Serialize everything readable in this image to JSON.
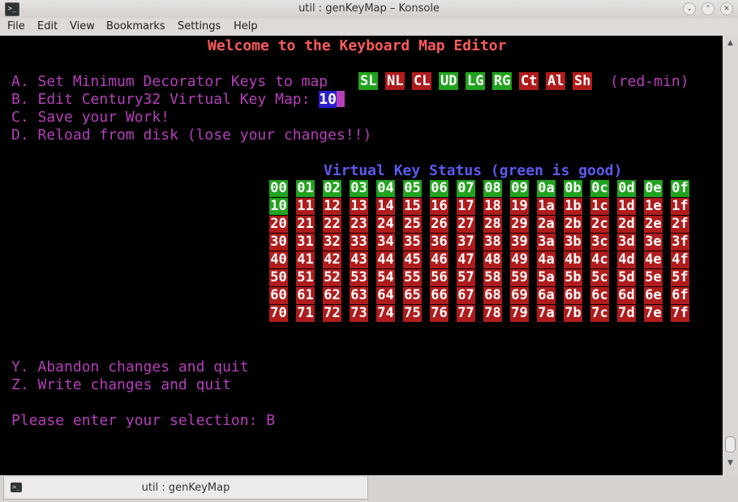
{
  "window": {
    "title": "util : genKeyMap – Konsole"
  },
  "menu": [
    "File",
    "Edit",
    "View",
    "Bookmarks",
    "Settings",
    "Help"
  ],
  "screen": {
    "header": "Welcome to the Keyboard Map Editor",
    "option_a": "A. Set Minimum Decorator Keys to map",
    "decorators": [
      {
        "label": "SL",
        "color": "green"
      },
      {
        "label": "NL",
        "color": "red"
      },
      {
        "label": "CL",
        "color": "red"
      },
      {
        "label": "UD",
        "color": "green"
      },
      {
        "label": "LG",
        "color": "green"
      },
      {
        "label": "RG",
        "color": "green"
      },
      {
        "label": "Ct",
        "color": "red"
      },
      {
        "label": "Al",
        "color": "red"
      },
      {
        "label": "Sh",
        "color": "red"
      }
    ],
    "red_min": "(red-min)",
    "option_b": "B. Edit Century32 Virtual Key Map: ",
    "option_b_value": "10",
    "option_c": "C. Save your Work!",
    "option_d": "D. Reload from disk (lose your changes!!)",
    "grid_title": "Virtual Key Status (green is good)",
    "green_keys": [
      "00",
      "01",
      "02",
      "03",
      "04",
      "05",
      "06",
      "07",
      "08",
      "09",
      "0a",
      "0b",
      "0c",
      "0d",
      "0e",
      "0f",
      "10"
    ],
    "option_y": "Y. Abandon changes and quit",
    "option_z": "Z. Write changes and quit",
    "prompt": "Please enter your selection: B"
  },
  "colors": {
    "green": "#22a31f",
    "red": "#b01c1c",
    "magenta": "#b63fbb",
    "header": "#ff5a5a",
    "blue": "#5a5af0"
  },
  "tab": {
    "label": "util : genKeyMap"
  }
}
